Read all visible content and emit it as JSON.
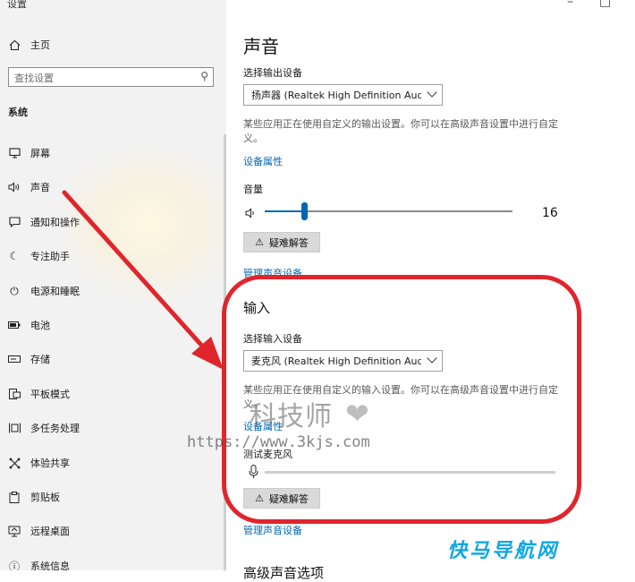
{
  "window": {
    "app_title": "设置",
    "minimize": "–",
    "maximize": "□"
  },
  "sidebar": {
    "home_label": "主页",
    "search_placeholder": "查找设置",
    "section_title": "系统",
    "items": [
      {
        "label": "屏幕",
        "icon": "display-icon"
      },
      {
        "label": "声音",
        "icon": "speaker-icon"
      },
      {
        "label": "通知和操作",
        "icon": "notification-icon"
      },
      {
        "label": "专注助手",
        "icon": "moon-icon"
      },
      {
        "label": "电源和睡眠",
        "icon": "power-icon"
      },
      {
        "label": "电池",
        "icon": "battery-icon"
      },
      {
        "label": "存储",
        "icon": "storage-icon"
      },
      {
        "label": "平板模式",
        "icon": "tablet-icon"
      },
      {
        "label": "多任务处理",
        "icon": "multitask-icon"
      },
      {
        "label": "体验共享",
        "icon": "share-icon"
      },
      {
        "label": "剪贴板",
        "icon": "clipboard-icon"
      },
      {
        "label": "远程桌面",
        "icon": "remote-desktop-icon"
      },
      {
        "label": "系统信息",
        "icon": "info-icon"
      }
    ]
  },
  "main": {
    "title": "声音",
    "output": {
      "select_label": "选择输出设备",
      "device": "扬声器 (Realtek High Definition Audi...",
      "description": "某些应用正在使用自定义的输出设置。你可以在高级声音设置中进行自定义。",
      "properties_link": "设备属性",
      "volume_label": "音量",
      "volume_value": 16,
      "volume_display": "16",
      "troubleshoot_label": "疑难解答",
      "manage_link": "管理声音设备"
    },
    "input": {
      "heading": "输入",
      "select_label": "选择输入设备",
      "device": "麦克风 (Realtek High Definition Audi...",
      "description": "某些应用正在使用自定义的输入设置。你可以在高级声音设置中进行自定义。",
      "properties_link": "设备属性",
      "test_label": "测试麦克风",
      "troubleshoot_label": "疑难解答",
      "manage_link": "管理声音设备"
    },
    "next_heading": "高级声音选项"
  },
  "watermark": {
    "site_name": "科技师",
    "url": "https://www.3kjs.com",
    "brand": "快马导航网"
  },
  "colors": {
    "accent": "#0067b8",
    "highlight": "#e0252d",
    "sidebar_bg": "#f2f2f2",
    "brand": "#0ea6e8"
  }
}
